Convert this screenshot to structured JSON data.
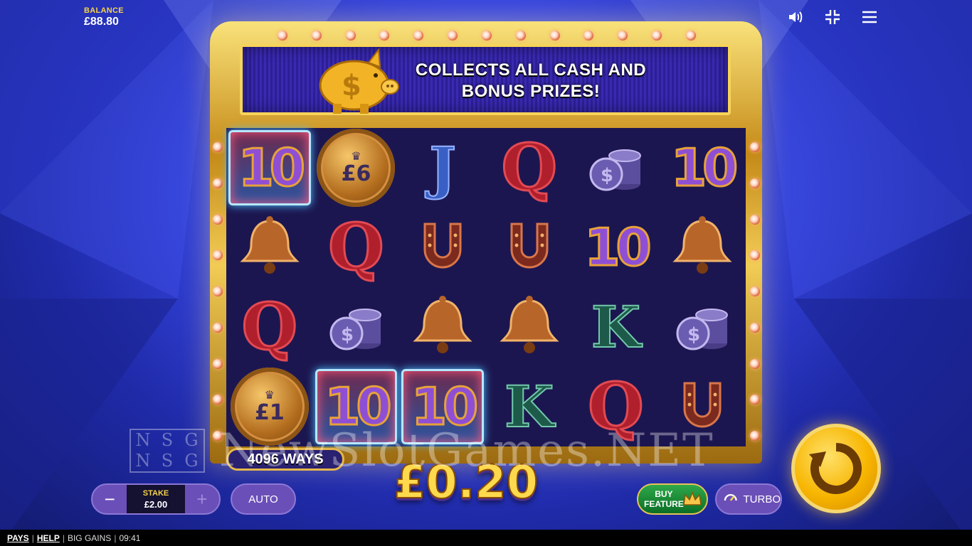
{
  "balance": {
    "label": "BALANCE",
    "value": "£88.80"
  },
  "top_icons": [
    "sound-icon",
    "minimize-icon",
    "menu-icon"
  ],
  "banner": {
    "line1": "COLLECTS ALL CASH AND",
    "line2": "BONUS PRIZES!"
  },
  "reels": [
    [
      "10",
      "coin:£6",
      "J",
      "Q",
      "coins",
      "10"
    ],
    [
      "bell",
      "Q",
      "horseshoe",
      "horseshoe",
      "10",
      "bell"
    ],
    [
      "Q",
      "coins",
      "bell",
      "bell",
      "K",
      "coins"
    ],
    [
      "coin:£1",
      "10",
      "10",
      "K",
      "Q",
      "horseshoe"
    ]
  ],
  "winning_cells": [
    [
      0,
      0
    ],
    [
      3,
      1
    ],
    [
      3,
      2
    ]
  ],
  "ways": "4096 WAYS",
  "win_amount": "£0.20",
  "watermark": {
    "logo": [
      "N",
      "S",
      "G",
      "N",
      "S",
      "G"
    ],
    "text": "NewSlotGames.NET"
  },
  "stake": {
    "label": "STAKE",
    "value": "£2.00",
    "minus": "−",
    "plus": "+"
  },
  "auto_label": "AUTO",
  "buy_feature": {
    "line1": "BUY",
    "line2": "FEATURE"
  },
  "turbo_label": "TURBO",
  "footer": {
    "pays": "PAYS",
    "help": "HELP",
    "game": "BIG GAINS",
    "time": "09:41",
    "sep": "|"
  },
  "colors": {
    "gold": "#f5d24a",
    "button_purple": "#6b4fb8",
    "buy_green": "#2fa84a"
  }
}
